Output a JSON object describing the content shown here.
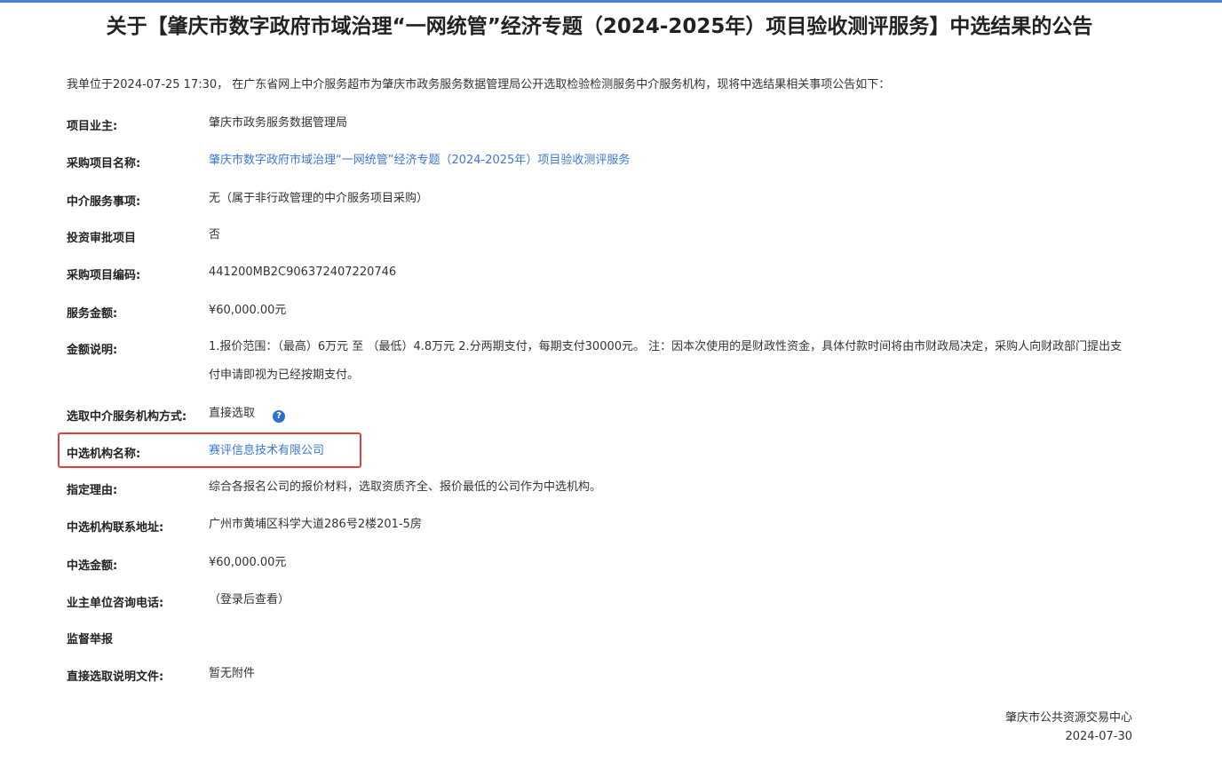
{
  "title": "关于【肇庆市数字政府市域治理“一网统管”经济专题（2024-2025年）项目验收测评服务】中选结果的公告",
  "intro": "我单位于2024-07-25 17:30， 在广东省网上中介服务超市为肇庆市政务服务数据管理局公开选取检验检测服务中介服务机构，现将中选结果相关事项公告如下：",
  "fields": {
    "owner": {
      "label": "项目业主:",
      "value": "肇庆市政务服务数据管理局"
    },
    "project_name": {
      "label": "采购项目名称:",
      "value": "肇庆市数字政府市域治理“一网统管”经济专题（2024-2025年）项目验收测评服务"
    },
    "service_item": {
      "label": "中介服务事项:",
      "value": "无（属于非行政管理的中介服务项目采购）"
    },
    "investment_approval": {
      "label": "投资审批项目",
      "value": "否"
    },
    "project_code": {
      "label": "采购项目编码:",
      "value": "441200MB2C906372407220746"
    },
    "service_amount": {
      "label": "服务金额:",
      "value": "¥60,000.00元"
    },
    "amount_note": {
      "label": "金额说明:",
      "value": "1.报价范围：（最高）6万元 至 （最低）4.8万元 2.分两期支付，每期支付30000元。 注：因本次使用的是财政性资金，具体付款时间将由市财政局决定，采购人向财政部门提出支付申请即视为已经按期支付。"
    },
    "selection_method": {
      "label": "选取中介服务机构方式:",
      "value": "直接选取"
    },
    "selected_org": {
      "label": "中选机构名称:",
      "value": "赛评信息技术有限公司"
    },
    "reason": {
      "label": "指定理由:",
      "value": "综合各报名公司的报价材料，选取资质齐全、报价最低的公司作为中选机构。"
    },
    "address": {
      "label": "中选机构联系地址:",
      "value": "广州市黄埔区科学大道286号2楼201-5房"
    },
    "selected_amount": {
      "label": "中选金额:",
      "value": "¥60,000.00元"
    },
    "phone": {
      "label": "业主单位咨询电话:",
      "value": "（登录后查看）"
    },
    "supervision": {
      "label": "监督举报",
      "value": ""
    },
    "docs": {
      "label": "直接选取说明文件:",
      "value": "暂无附件"
    }
  },
  "help_icon": {
    "icon": "question-circle-icon",
    "glyph": "?"
  },
  "footer": {
    "org": "肇庆市公共资源交易中心",
    "date": "2024-07-30"
  },
  "colors": {
    "accent": "#4a7fd8",
    "link": "#3c78d8",
    "highlight": "#e0403a"
  }
}
